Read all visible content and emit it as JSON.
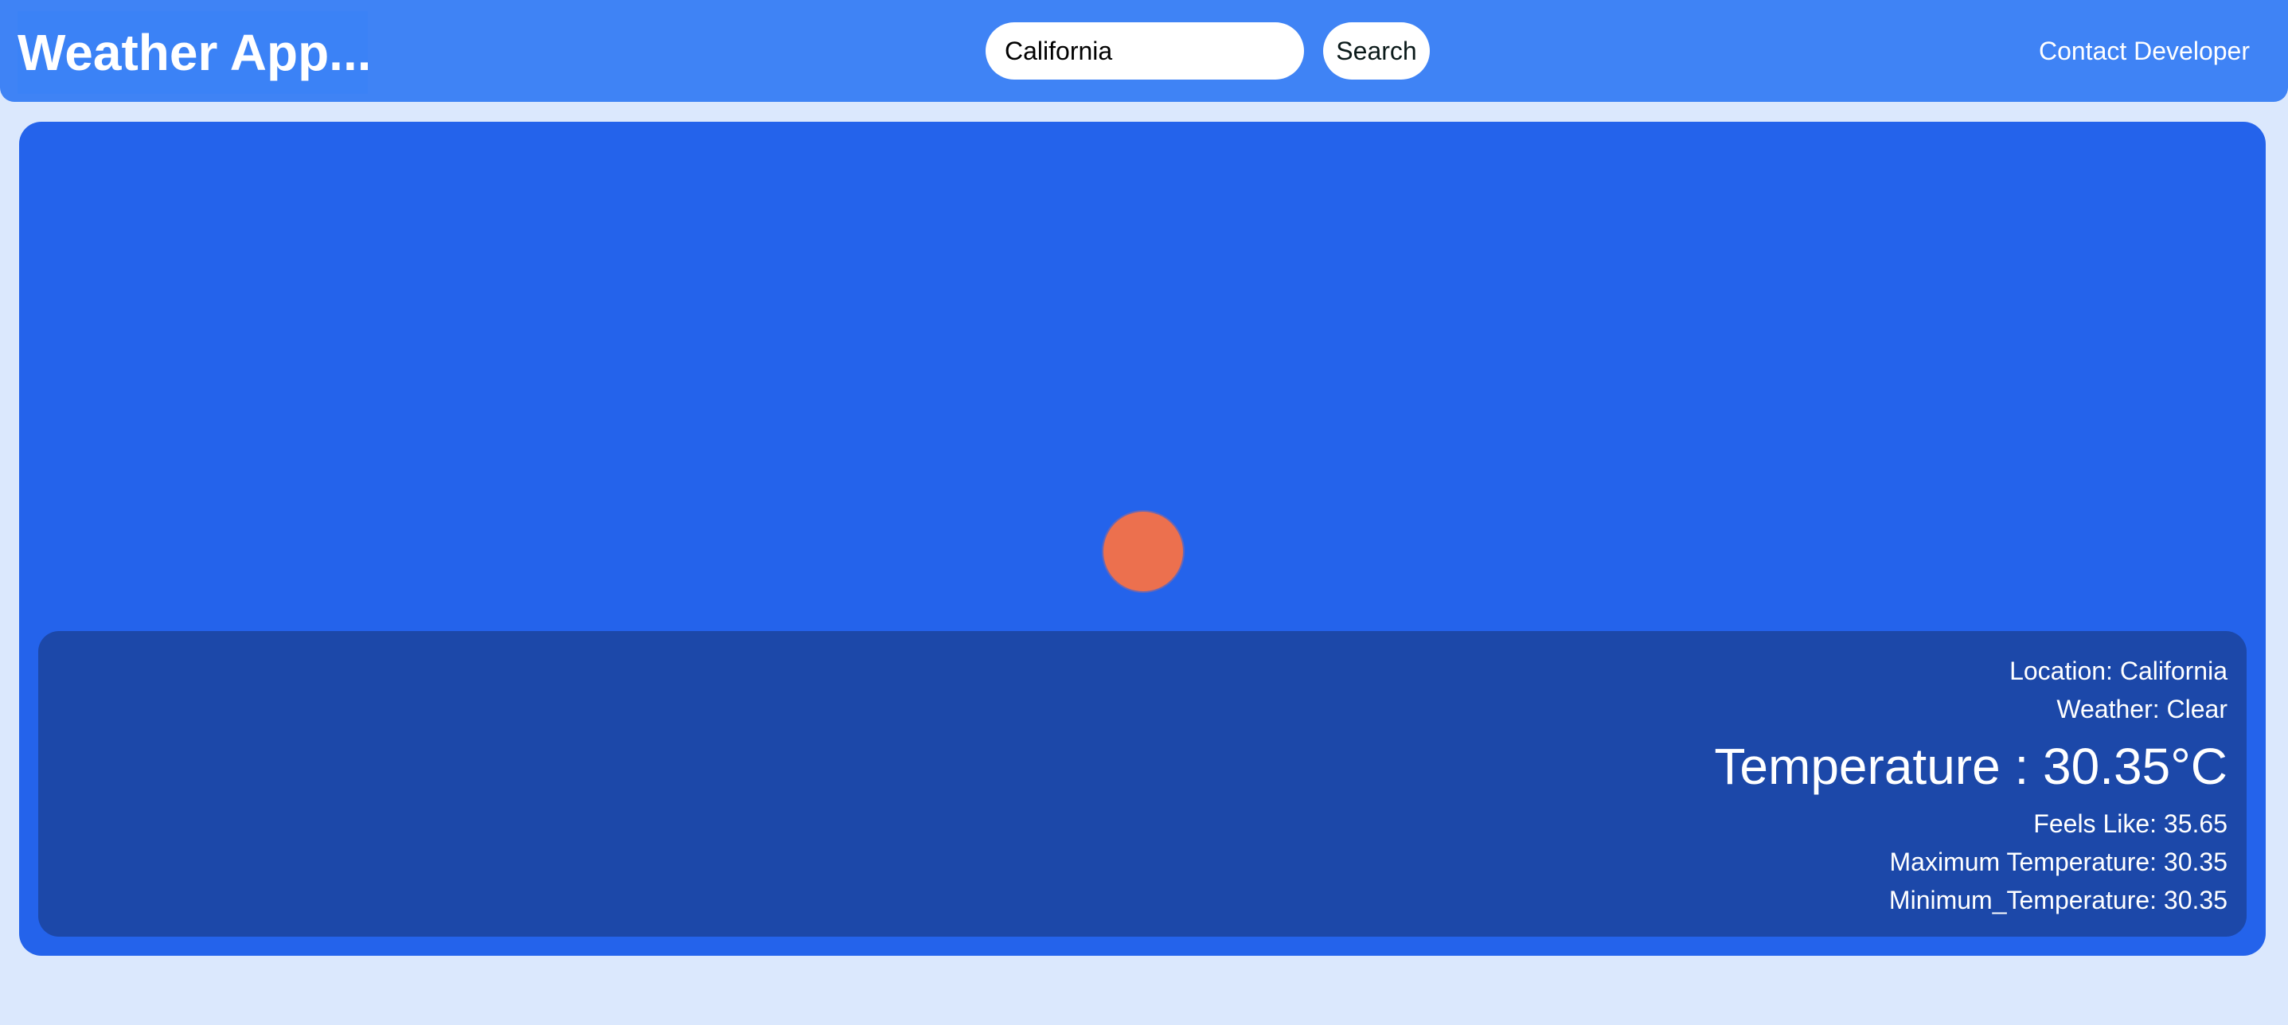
{
  "header": {
    "brand": "Weather App...",
    "search": {
      "value": "California",
      "placeholder": ""
    },
    "search_button_label": "Search",
    "contact_link_label": "Contact Developer"
  },
  "weather": {
    "icon": "sun-icon",
    "icon_color": "#ec704e",
    "location": "Location: California",
    "condition": "Weather: Clear",
    "temperature": "Temperature : 30.35°C",
    "feels_like": "Feels Like: 35.65",
    "max_temperature": "Maximum Temperature: 30.35",
    "min_temperature": "Minimum_Temperature: 30.35"
  },
  "colors": {
    "page_background": "#dbe8fd",
    "navbar": "#3f83f5",
    "card": "#2463eb",
    "info_panel": "#1c48a9"
  }
}
